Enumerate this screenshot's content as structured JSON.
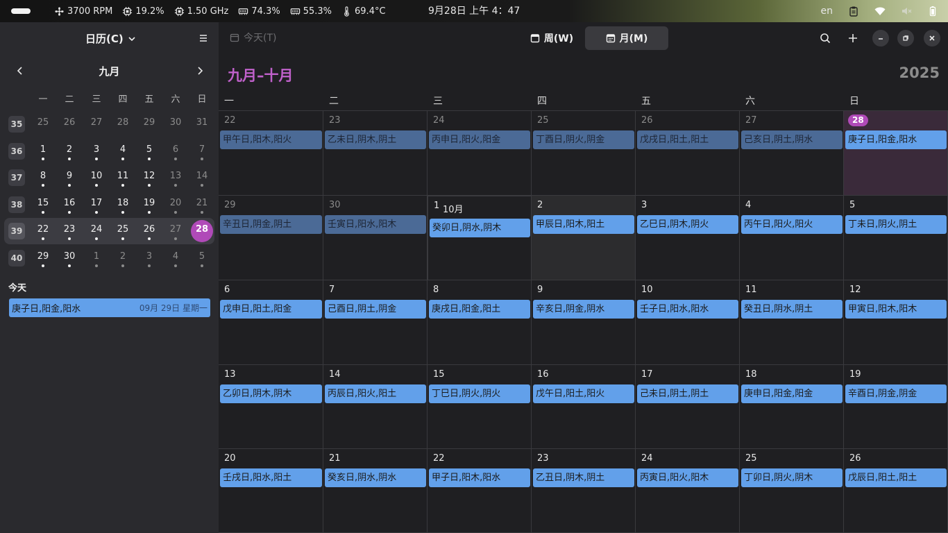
{
  "topbar": {
    "fan": "3700 RPM",
    "cpu": "19.2%",
    "freq": "1.50 GHz",
    "mem": "74.3%",
    "swap": "55.3%",
    "temp": "69.4°C",
    "clock": "9月28日  上午 4：47",
    "lang": "en"
  },
  "sidebar": {
    "title": "日历(C)",
    "month": "九月",
    "dow": [
      "一",
      "二",
      "三",
      "四",
      "五",
      "六",
      "日"
    ],
    "weeks": [
      {
        "wk": "35",
        "days": [
          "25",
          "26",
          "27",
          "28",
          "29",
          "30",
          "31"
        ],
        "dim": [
          true,
          true,
          true,
          true,
          true,
          true,
          true
        ],
        "dot": [
          false,
          false,
          false,
          false,
          false,
          false,
          false
        ]
      },
      {
        "wk": "36",
        "days": [
          "1",
          "2",
          "3",
          "4",
          "5",
          "6",
          "7"
        ],
        "dim": [
          false,
          false,
          false,
          false,
          false,
          true,
          true
        ],
        "dot": [
          true,
          true,
          true,
          true,
          true,
          true,
          true
        ]
      },
      {
        "wk": "37",
        "days": [
          "8",
          "9",
          "10",
          "11",
          "12",
          "13",
          "14"
        ],
        "dim": [
          false,
          false,
          false,
          false,
          false,
          true,
          true
        ],
        "dot": [
          true,
          true,
          true,
          true,
          true,
          true,
          true
        ]
      },
      {
        "wk": "38",
        "days": [
          "15",
          "16",
          "17",
          "18",
          "19",
          "20",
          "21"
        ],
        "dim": [
          false,
          false,
          false,
          false,
          false,
          true,
          true
        ],
        "dot": [
          true,
          true,
          true,
          true,
          true,
          true,
          true
        ]
      },
      {
        "wk": "39",
        "days": [
          "22",
          "23",
          "24",
          "25",
          "26",
          "27",
          "28"
        ],
        "dim": [
          false,
          false,
          false,
          false,
          false,
          true,
          false
        ],
        "dot": [
          true,
          true,
          true,
          true,
          true,
          true,
          false
        ]
      },
      {
        "wk": "40",
        "days": [
          "29",
          "30",
          "1",
          "2",
          "3",
          "4",
          "5"
        ],
        "dim": [
          false,
          false,
          true,
          true,
          true,
          true,
          true
        ],
        "dot": [
          true,
          true,
          true,
          true,
          true,
          true,
          true
        ]
      }
    ],
    "today_label": "今天",
    "today_event": {
      "title": "庚子日,阳金,阳水",
      "when": "09月 29日 星期一"
    }
  },
  "header": {
    "today_btn": "今天(T)",
    "week_btn": "周(W)",
    "month_btn": "月(M)"
  },
  "main": {
    "range_title": "九月–十月",
    "year": "2025",
    "dow": [
      "一",
      "二",
      "三",
      "四",
      "五",
      "六",
      "日"
    ],
    "month_tag": "10月",
    "weeks": [
      [
        {
          "d": "22",
          "ev": "甲午日,阳木,阳火",
          "dim": true
        },
        {
          "d": "23",
          "ev": "乙未日,阴木,阴土",
          "dim": true
        },
        {
          "d": "24",
          "ev": "丙申日,阳火,阳金",
          "dim": true
        },
        {
          "d": "25",
          "ev": "丁酉日,阴火,阴金",
          "dim": true
        },
        {
          "d": "26",
          "ev": "戊戌日,阳土,阳土",
          "dim": true
        },
        {
          "d": "27",
          "ev": "己亥日,阴土,阴水",
          "dim": true
        },
        {
          "d": "28",
          "ev": "庚子日,阳金,阳水",
          "today": true
        }
      ],
      [
        {
          "d": "29",
          "ev": "辛丑日,阴金,阴土",
          "dim": true
        },
        {
          "d": "30",
          "ev": "壬寅日,阳水,阳木",
          "dim": true
        },
        {
          "d": "1",
          "ev": "癸卯日,阴水,阴木",
          "oct": true
        },
        {
          "d": "2",
          "ev": "甲辰日,阳木,阳土",
          "hover": true
        },
        {
          "d": "3",
          "ev": "乙巳日,阴木,阴火"
        },
        {
          "d": "4",
          "ev": "丙午日,阳火,阳火"
        },
        {
          "d": "5",
          "ev": "丁未日,阴火,阴土"
        }
      ],
      [
        {
          "d": "6",
          "ev": "戊申日,阳土,阳金"
        },
        {
          "d": "7",
          "ev": "己酉日,阴土,阴金"
        },
        {
          "d": "8",
          "ev": "庚戌日,阳金,阳土"
        },
        {
          "d": "9",
          "ev": "辛亥日,阴金,阴水"
        },
        {
          "d": "10",
          "ev": "壬子日,阳水,阳水"
        },
        {
          "d": "11",
          "ev": "癸丑日,阴水,阴土"
        },
        {
          "d": "12",
          "ev": "甲寅日,阳木,阳木"
        }
      ],
      [
        {
          "d": "13",
          "ev": "乙卯日,阴木,阴木"
        },
        {
          "d": "14",
          "ev": "丙辰日,阳火,阳土"
        },
        {
          "d": "15",
          "ev": "丁巳日,阴火,阴火"
        },
        {
          "d": "16",
          "ev": "戊午日,阳土,阳火"
        },
        {
          "d": "17",
          "ev": "己未日,阴土,阴土"
        },
        {
          "d": "18",
          "ev": "庚申日,阳金,阳金"
        },
        {
          "d": "19",
          "ev": "辛酉日,阴金,阴金"
        }
      ],
      [
        {
          "d": "20",
          "ev": "壬戌日,阳水,阳土"
        },
        {
          "d": "21",
          "ev": "癸亥日,阴水,阴水"
        },
        {
          "d": "22",
          "ev": "甲子日,阳木,阳水"
        },
        {
          "d": "23",
          "ev": "乙丑日,阴木,阴土"
        },
        {
          "d": "24",
          "ev": "丙寅日,阳火,阳木"
        },
        {
          "d": "25",
          "ev": "丁卯日,阴火,阴木"
        },
        {
          "d": "26",
          "ev": "戊辰日,阳土,阳土"
        }
      ]
    ]
  },
  "colors": {
    "accent": "#c061cb",
    "event": "#62a0ea",
    "today": "#b04ab8"
  }
}
